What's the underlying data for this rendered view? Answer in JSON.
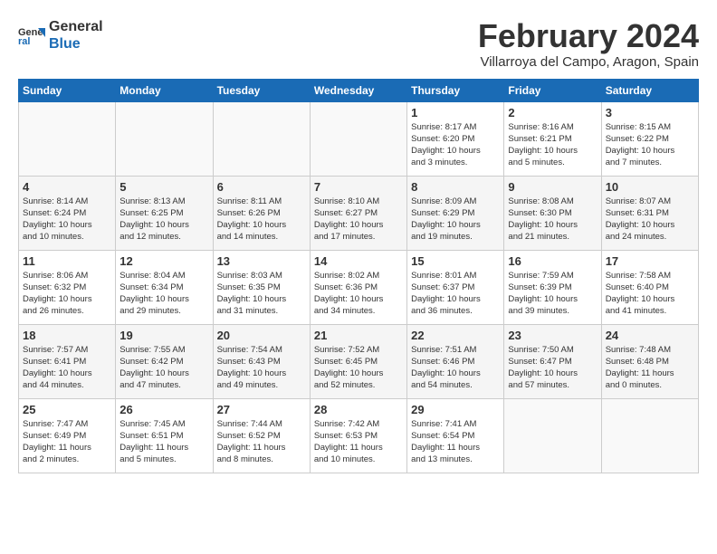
{
  "header": {
    "logo_line1": "General",
    "logo_line2": "Blue",
    "title": "February 2024",
    "subtitle": "Villarroya del Campo, Aragon, Spain"
  },
  "days_of_week": [
    "Sunday",
    "Monday",
    "Tuesday",
    "Wednesday",
    "Thursday",
    "Friday",
    "Saturday"
  ],
  "weeks": [
    [
      {
        "day": "",
        "info": ""
      },
      {
        "day": "",
        "info": ""
      },
      {
        "day": "",
        "info": ""
      },
      {
        "day": "",
        "info": ""
      },
      {
        "day": "1",
        "info": "Sunrise: 8:17 AM\nSunset: 6:20 PM\nDaylight: 10 hours\nand 3 minutes."
      },
      {
        "day": "2",
        "info": "Sunrise: 8:16 AM\nSunset: 6:21 PM\nDaylight: 10 hours\nand 5 minutes."
      },
      {
        "day": "3",
        "info": "Sunrise: 8:15 AM\nSunset: 6:22 PM\nDaylight: 10 hours\nand 7 minutes."
      }
    ],
    [
      {
        "day": "4",
        "info": "Sunrise: 8:14 AM\nSunset: 6:24 PM\nDaylight: 10 hours\nand 10 minutes."
      },
      {
        "day": "5",
        "info": "Sunrise: 8:13 AM\nSunset: 6:25 PM\nDaylight: 10 hours\nand 12 minutes."
      },
      {
        "day": "6",
        "info": "Sunrise: 8:11 AM\nSunset: 6:26 PM\nDaylight: 10 hours\nand 14 minutes."
      },
      {
        "day": "7",
        "info": "Sunrise: 8:10 AM\nSunset: 6:27 PM\nDaylight: 10 hours\nand 17 minutes."
      },
      {
        "day": "8",
        "info": "Sunrise: 8:09 AM\nSunset: 6:29 PM\nDaylight: 10 hours\nand 19 minutes."
      },
      {
        "day": "9",
        "info": "Sunrise: 8:08 AM\nSunset: 6:30 PM\nDaylight: 10 hours\nand 21 minutes."
      },
      {
        "day": "10",
        "info": "Sunrise: 8:07 AM\nSunset: 6:31 PM\nDaylight: 10 hours\nand 24 minutes."
      }
    ],
    [
      {
        "day": "11",
        "info": "Sunrise: 8:06 AM\nSunset: 6:32 PM\nDaylight: 10 hours\nand 26 minutes."
      },
      {
        "day": "12",
        "info": "Sunrise: 8:04 AM\nSunset: 6:34 PM\nDaylight: 10 hours\nand 29 minutes."
      },
      {
        "day": "13",
        "info": "Sunrise: 8:03 AM\nSunset: 6:35 PM\nDaylight: 10 hours\nand 31 minutes."
      },
      {
        "day": "14",
        "info": "Sunrise: 8:02 AM\nSunset: 6:36 PM\nDaylight: 10 hours\nand 34 minutes."
      },
      {
        "day": "15",
        "info": "Sunrise: 8:01 AM\nSunset: 6:37 PM\nDaylight: 10 hours\nand 36 minutes."
      },
      {
        "day": "16",
        "info": "Sunrise: 7:59 AM\nSunset: 6:39 PM\nDaylight: 10 hours\nand 39 minutes."
      },
      {
        "day": "17",
        "info": "Sunrise: 7:58 AM\nSunset: 6:40 PM\nDaylight: 10 hours\nand 41 minutes."
      }
    ],
    [
      {
        "day": "18",
        "info": "Sunrise: 7:57 AM\nSunset: 6:41 PM\nDaylight: 10 hours\nand 44 minutes."
      },
      {
        "day": "19",
        "info": "Sunrise: 7:55 AM\nSunset: 6:42 PM\nDaylight: 10 hours\nand 47 minutes."
      },
      {
        "day": "20",
        "info": "Sunrise: 7:54 AM\nSunset: 6:43 PM\nDaylight: 10 hours\nand 49 minutes."
      },
      {
        "day": "21",
        "info": "Sunrise: 7:52 AM\nSunset: 6:45 PM\nDaylight: 10 hours\nand 52 minutes."
      },
      {
        "day": "22",
        "info": "Sunrise: 7:51 AM\nSunset: 6:46 PM\nDaylight: 10 hours\nand 54 minutes."
      },
      {
        "day": "23",
        "info": "Sunrise: 7:50 AM\nSunset: 6:47 PM\nDaylight: 10 hours\nand 57 minutes."
      },
      {
        "day": "24",
        "info": "Sunrise: 7:48 AM\nSunset: 6:48 PM\nDaylight: 11 hours\nand 0 minutes."
      }
    ],
    [
      {
        "day": "25",
        "info": "Sunrise: 7:47 AM\nSunset: 6:49 PM\nDaylight: 11 hours\nand 2 minutes."
      },
      {
        "day": "26",
        "info": "Sunrise: 7:45 AM\nSunset: 6:51 PM\nDaylight: 11 hours\nand 5 minutes."
      },
      {
        "day": "27",
        "info": "Sunrise: 7:44 AM\nSunset: 6:52 PM\nDaylight: 11 hours\nand 8 minutes."
      },
      {
        "day": "28",
        "info": "Sunrise: 7:42 AM\nSunset: 6:53 PM\nDaylight: 11 hours\nand 10 minutes."
      },
      {
        "day": "29",
        "info": "Sunrise: 7:41 AM\nSunset: 6:54 PM\nDaylight: 11 hours\nand 13 minutes."
      },
      {
        "day": "",
        "info": ""
      },
      {
        "day": "",
        "info": ""
      }
    ]
  ]
}
